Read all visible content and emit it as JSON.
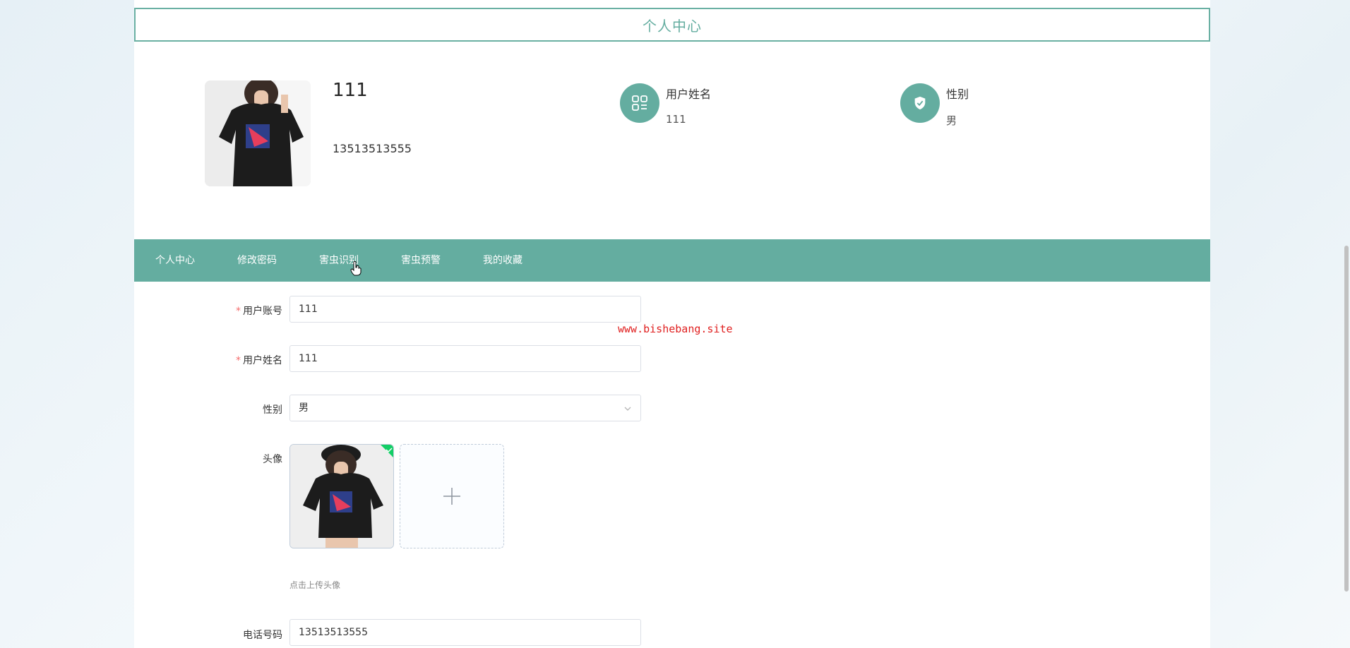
{
  "header": {
    "title": "个人中心"
  },
  "profile": {
    "name": "111",
    "phone": "13513513555",
    "info": [
      {
        "label": "用户姓名",
        "value": "111",
        "icon": "grid-list-icon"
      },
      {
        "label": "性别",
        "value": "男",
        "icon": "shield-check-icon"
      }
    ]
  },
  "tabs": [
    {
      "label": "个人中心"
    },
    {
      "label": "修改密码"
    },
    {
      "label": "害虫识别"
    },
    {
      "label": "害虫预警"
    },
    {
      "label": "我的收藏"
    }
  ],
  "form": {
    "account": {
      "label": "用户账号",
      "value": "111",
      "required": "*"
    },
    "username": {
      "label": "用户姓名",
      "value": "111",
      "required": "*"
    },
    "gender": {
      "label": "性别",
      "value": "男"
    },
    "avatar": {
      "label": "头像",
      "hint": "点击上传头像"
    },
    "phone": {
      "label": "电话号码",
      "value": "13513513555"
    }
  },
  "watermark": "www.bishebang.site",
  "colors": {
    "accent": "#64ada0",
    "required": "#f56c6c",
    "success": "#13ce66"
  }
}
